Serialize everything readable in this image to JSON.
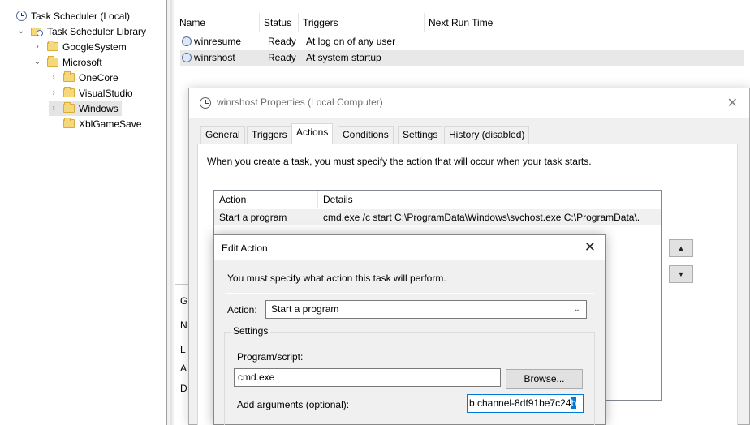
{
  "tree": {
    "root": "Task Scheduler (Local)",
    "library": "Task Scheduler Library",
    "google": "GoogleSystem",
    "microsoft": "Microsoft",
    "onecore": "OneCore",
    "visualstudio": "VisualStudio",
    "windows": "Windows",
    "xbl": "XblGameSave"
  },
  "task_list": {
    "columns": [
      "Name",
      "Status",
      "Triggers",
      "Next Run Time"
    ],
    "rows": [
      {
        "name": "winresume",
        "status": "Ready",
        "trigger": "At log on of any user"
      },
      {
        "name": "winrshost",
        "status": "Ready",
        "trigger": "At system startup"
      }
    ]
  },
  "lower_panel": {
    "chars": [
      "G",
      "N",
      "L",
      "A",
      "D"
    ]
  },
  "properties": {
    "title": "winrshost Properties (Local Computer)",
    "tabs": [
      "General",
      "Triggers",
      "Actions",
      "Conditions",
      "Settings",
      "History (disabled)"
    ],
    "active_tab": "Actions",
    "instruction": "When you create a task, you must specify the action that will occur when your task starts.",
    "grid": {
      "col_action": "Action",
      "col_details": "Details",
      "row_action": "Start a program",
      "row_details": "cmd.exe /c start C:\\ProgramData\\Windows\\svchost.exe C:\\ProgramData\\."
    }
  },
  "edit_action": {
    "title": "Edit Action",
    "instruction": "You must specify what action this task will perform.",
    "action_label": "Action:",
    "action_value": "Start a program",
    "settings_label": "Settings",
    "program_label": "Program/script:",
    "program_value": "cmd.exe",
    "browse_label": "Browse...",
    "args_label": "Add arguments (optional):",
    "args_value": "b channel-8df91be7c24",
    "args_selected": "b"
  },
  "icons": {
    "close": "✕",
    "up": "▲",
    "down": "▼"
  }
}
